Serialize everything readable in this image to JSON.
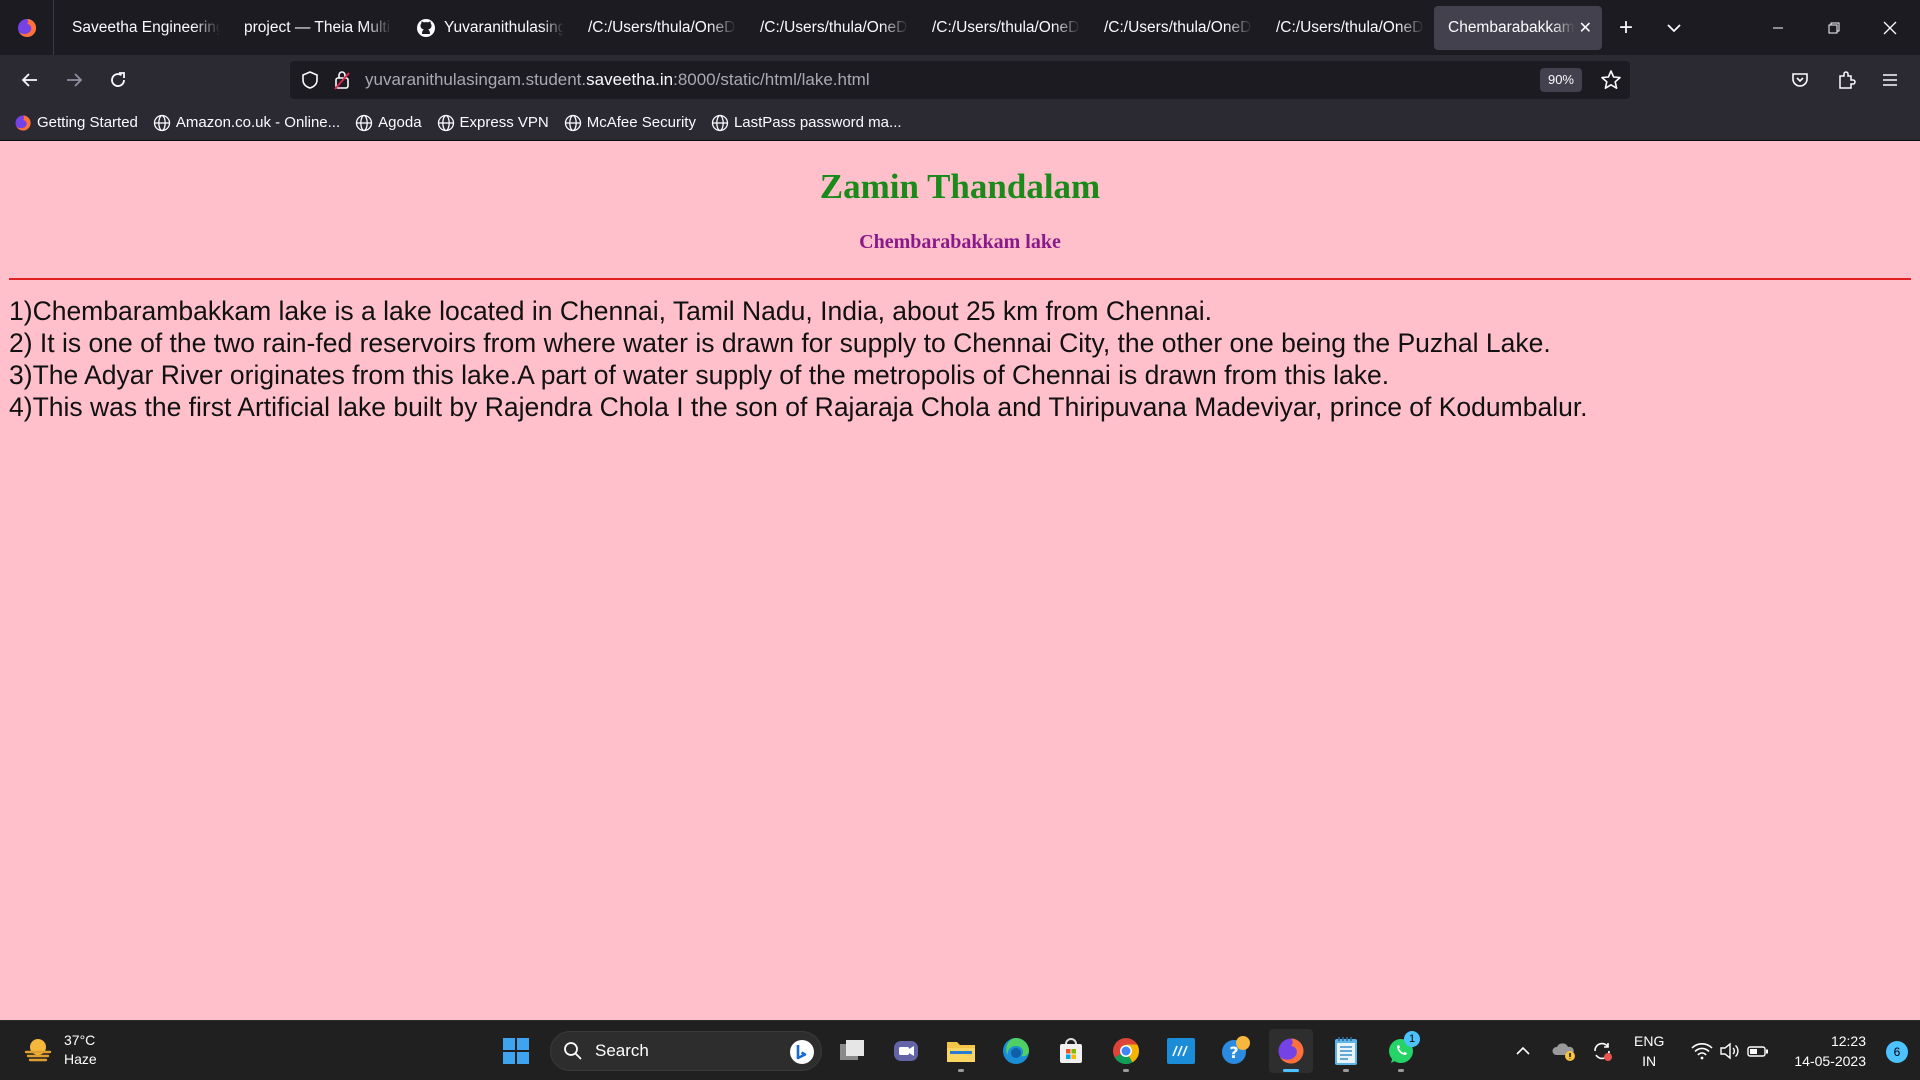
{
  "browser": {
    "tabs": [
      {
        "label": "Saveetha Engineering",
        "icon": "none"
      },
      {
        "label": "project — Theia Multi",
        "icon": "none"
      },
      {
        "label": "Yuvaranithulasing",
        "icon": "github-icon"
      },
      {
        "label": "/C:/Users/thula/OneD",
        "icon": "none"
      },
      {
        "label": "/C:/Users/thula/OneD",
        "icon": "none"
      },
      {
        "label": "/C:/Users/thula/OneD",
        "icon": "none"
      },
      {
        "label": "/C:/Users/thula/OneD",
        "icon": "none"
      },
      {
        "label": "/C:/Users/thula/OneD",
        "icon": "none"
      },
      {
        "label": "Chembarabakkam l",
        "icon": "none",
        "active": true
      }
    ],
    "url_prefix": "yuvaranithulasingam.student.",
    "url_domain": "saveetha.in",
    "url_suffix": ":8000/static/html/lake.html",
    "zoom": "90%",
    "bookmarks": [
      "Getting Started",
      "Amazon.co.uk - Online...",
      "Agoda",
      "Express VPN",
      "McAfee Security",
      "LastPass password ma..."
    ]
  },
  "page": {
    "title": "Zamin Thandalam",
    "subtitle": "Chembarabakkam lake",
    "lines": [
      "1)Chembarambakkam lake is a lake located in Chennai, Tamil Nadu, India, about 25 km from Chennai.",
      "2) It is one of the two rain-fed reservoirs from where water is drawn for supply to Chennai City, the other one being the Puzhal Lake.",
      "3)The Adyar River originates from this lake.A part of water supply of the metropolis of Chennai is drawn from this lake.",
      "4)This was the first Artificial lake built by Rajendra Chola I the son of Rajaraja Chola and Thiripuvana Madeviyar, prince of Kodumbalur."
    ],
    "colors": {
      "background": "#ffc0cb",
      "title": "#1a8a1a",
      "subtitle": "#8a1a8a",
      "rule": "#e02020"
    }
  },
  "taskbar": {
    "weather_temp": "37°C",
    "weather_desc": "Haze",
    "search_label": "Search",
    "lang_line1": "ENG",
    "lang_line2": "IN",
    "time": "12:23",
    "date": "14-05-2023",
    "notification_count": "6",
    "whatsapp_badge": "1"
  }
}
